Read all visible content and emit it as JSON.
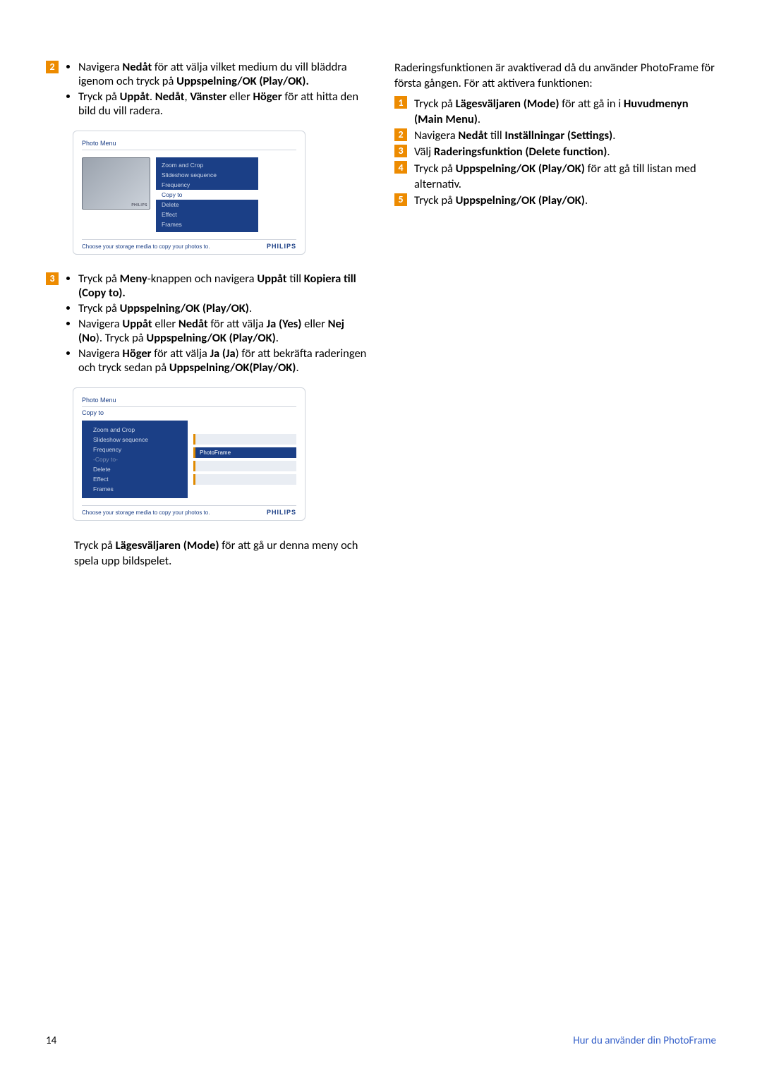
{
  "left": {
    "step2": {
      "bullet1_pre": "Navigera ",
      "bullet1_b1": "Nedåt",
      "bullet1_mid": " för att välja vilket medium du vill bläddra igenom och tryck på ",
      "bullet1_b2": "Uppspelning/OK (Play/OK).",
      "bullet2_pre": "Tryck på ",
      "bullet2_b1": "Uppåt",
      "bullet2_mid1": ". ",
      "bullet2_b2": "Nedåt",
      "bullet2_mid2": ", ",
      "bullet2_b3": "Vänster",
      "bullet2_mid3": " eller ",
      "bullet2_b4": "Höger",
      "bullet2_end": " för att hitta den bild du vill radera."
    },
    "shot1": {
      "title": "Photo Menu",
      "menu": [
        "Zoom and Crop",
        "Slideshow sequence",
        "Frequency",
        "Copy to",
        "Delete",
        "Effect",
        "Frames"
      ],
      "sel_index": 3,
      "hint": "Choose your storage media to copy your photos to.",
      "logo": "PHILIPS"
    },
    "step3": {
      "b1_pre": "Tryck på ",
      "b1_b1": "Meny",
      "b1_mid": "-knappen och navigera ",
      "b1_b2": "Uppåt",
      "b1_mid2": " till ",
      "b1_b3": "Kopiera till (Copy to).",
      "b2_pre": "Tryck på ",
      "b2_b1": "Uppspelning/OK (Play/OK)",
      "b2_end": ".",
      "b3_pre": "Navigera ",
      "b3_b1": "Uppåt",
      "b3_mid1": " eller ",
      "b3_b2": "Nedåt ",
      "b3_mid2": " för att välja ",
      "b3_b3": "Ja  (Yes)",
      "b3_mid3": " eller ",
      "b3_b4": "Nej (No",
      "b3_mid4": "). Tryck på ",
      "b3_b5": "Uppspelning/OK (Play/OK)",
      "b3_end": ".",
      "b4_pre": "Navigera ",
      "b4_b1": "Höger",
      "b4_mid1": " för att välja ",
      "b4_b2": "Ja (Ja",
      "b4_mid2": ") för att bekräfta raderingen och tryck sedan på ",
      "b4_b3": "Uppspelning/OK(Play/OK)",
      "b4_end": "."
    },
    "shot2": {
      "title": "Photo Menu",
      "subtitle": "Copy to",
      "menu": [
        "Zoom and Crop",
        "Slideshow sequence",
        "Frequency",
        "-Copy to-",
        "Delete",
        "Effect",
        "Frames"
      ],
      "dim_index": 3,
      "target": "PhotoFrame",
      "hint": "Choose your storage media to copy your photos to.",
      "logo": "PHILIPS"
    },
    "para_pre": "Tryck på ",
    "para_b": "Lägesväljaren (Mode)",
    "para_end": " för att gå ur denna meny och spela upp bildspelet."
  },
  "right": {
    "intro": "Raderingsfunktionen är avaktiverad då du använder PhotoFrame för första gången. För att aktivera funktionen:",
    "s1_pre": "Tryck på ",
    "s1_b1": "Lägesväljaren (Mode)",
    "s1_mid": " för att gå in i ",
    "s1_b2": "Huvudmenyn (Main Menu)",
    "s1_end": ".",
    "s2_pre": "Navigera ",
    "s2_b1": "Nedåt",
    "s2_mid": " till ",
    "s2_b2": "Inställningar (Settings)",
    "s2_end": ".",
    "s3_pre": "Välj ",
    "s3_b1": "Raderingsfunktion (Delete function)",
    "s3_end": ".",
    "s4_pre": "Tryck på ",
    "s4_b1": "Uppspelning/OK (Play/OK)",
    "s4_end": " för att gå till listan med alternativ.",
    "s5_pre": "Tryck på ",
    "s5_b1": "Uppspelning/OK (Play/OK)",
    "s5_end": "."
  },
  "footer": {
    "page": "14",
    "section": "Hur du använder din PhotoFrame"
  },
  "badges": {
    "n1": "1",
    "n2": "2",
    "n3": "3",
    "n4": "4",
    "n5": "5"
  }
}
